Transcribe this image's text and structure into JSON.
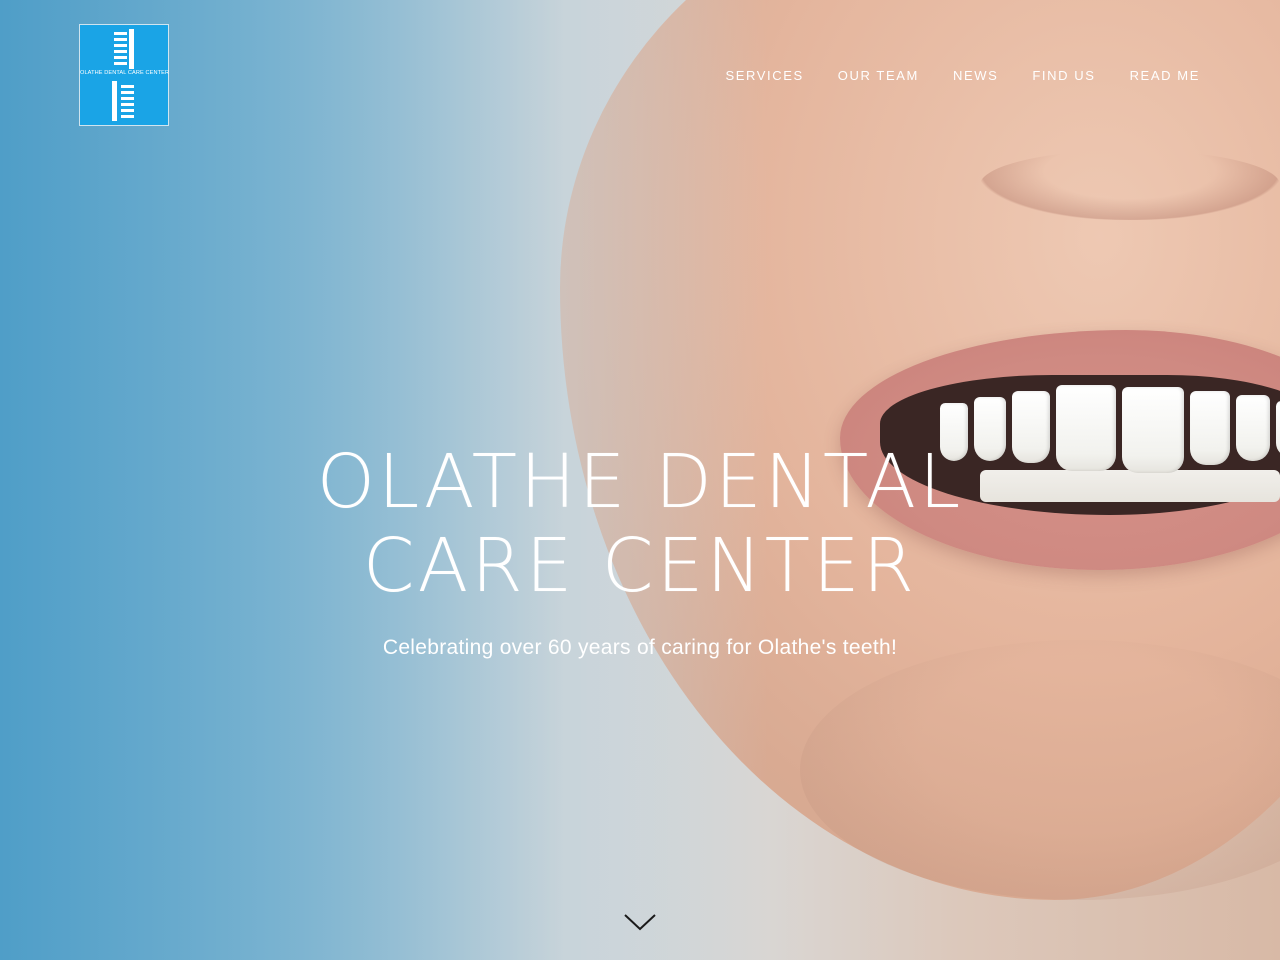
{
  "brand": {
    "logo_text": "OLATHE DENTAL CARE CENTER",
    "logo_color": "#1aa4e6"
  },
  "nav": {
    "items": [
      {
        "label": "SERVICES"
      },
      {
        "label": "OUR TEAM"
      },
      {
        "label": "NEWS"
      },
      {
        "label": "FIND US"
      },
      {
        "label": "READ ME"
      }
    ]
  },
  "hero": {
    "title_line1": "OLATHE DENTAL",
    "title_line2": "CARE CENTER",
    "subtitle": "Celebrating over 60 years of caring for Olathe's teeth!",
    "scroll_icon": "chevron-down-icon",
    "background_image": "smiling-face-photo"
  },
  "colors": {
    "text": "#ffffff",
    "background_left": "#4f9ec8",
    "background_right": "#d8b9a6"
  }
}
